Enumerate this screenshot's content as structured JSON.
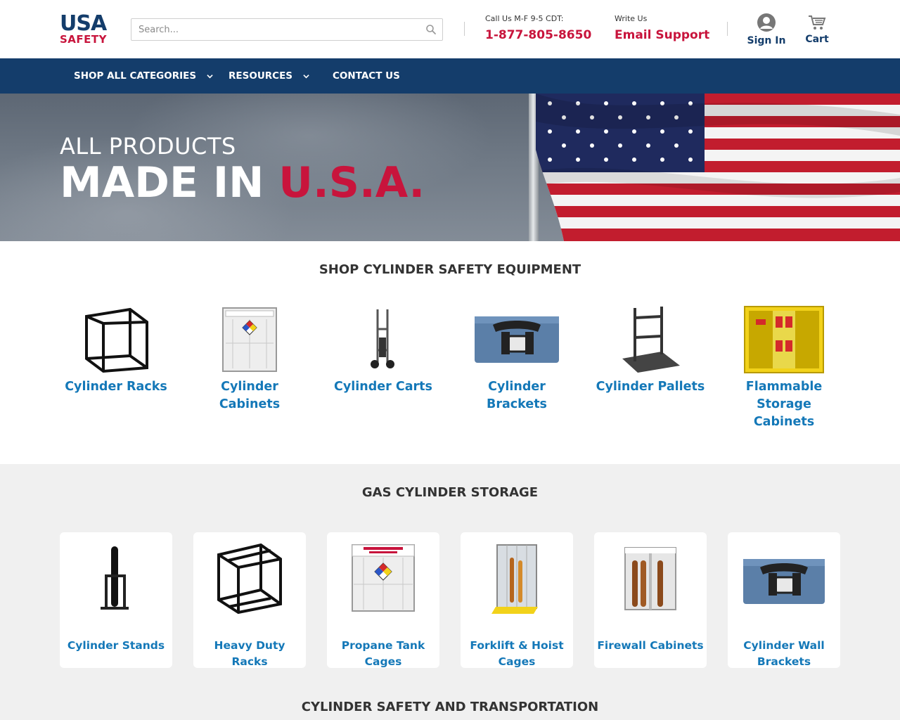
{
  "header": {
    "logo_line1": "USA",
    "logo_line2": "SAFETY",
    "search_placeholder": "Search...",
    "call_label": "Call Us M-F 9-5 CDT:",
    "phone": "1-877-805-8650",
    "write_label": "Write Us",
    "email_label": "Email Support",
    "sign_in": "Sign In",
    "cart": "Cart"
  },
  "nav": {
    "items": [
      {
        "label": "SHOP ALL CATEGORIES",
        "has_dropdown": true
      },
      {
        "label": "RESOURCES",
        "has_dropdown": true
      },
      {
        "label": "CONTACT US",
        "has_dropdown": false
      }
    ]
  },
  "hero": {
    "line1": "ALL PRODUCTS",
    "line2_white": "MADE IN ",
    "line2_red": "U.S.A."
  },
  "section1": {
    "title": "SHOP CYLINDER SAFETY EQUIPMENT",
    "items": [
      {
        "label": "Cylinder Racks",
        "icon": "cylinder-rack-image"
      },
      {
        "label": "Cylinder Cabinets",
        "icon": "cylinder-cabinet-image"
      },
      {
        "label": "Cylinder Carts",
        "icon": "cylinder-cart-image"
      },
      {
        "label": "Cylinder Brackets",
        "icon": "cylinder-bracket-image"
      },
      {
        "label": "Cylinder Pallets",
        "icon": "cylinder-pallet-image"
      },
      {
        "label": "Flammable Storage Cabinets",
        "icon": "flammable-cabinet-image"
      }
    ]
  },
  "section2": {
    "title": "GAS CYLINDER STORAGE",
    "items": [
      {
        "label": "Cylinder Stands",
        "icon": "cylinder-stand-image"
      },
      {
        "label": "Heavy Duty Racks",
        "icon": "heavy-duty-rack-image"
      },
      {
        "label": "Propane Tank Cages",
        "icon": "propane-cage-image"
      },
      {
        "label": "Forklift & Hoist Cages",
        "icon": "forklift-cage-image"
      },
      {
        "label": "Firewall Cabinets",
        "icon": "firewall-cabinet-image"
      },
      {
        "label": "Cylinder Wall Brackets",
        "icon": "wall-bracket-image"
      }
    ]
  },
  "section3": {
    "title": "CYLINDER SAFETY AND TRANSPORTATION"
  },
  "colors": {
    "navy": "#143d6b",
    "red": "#c8143c",
    "link_blue": "#1478b8"
  }
}
